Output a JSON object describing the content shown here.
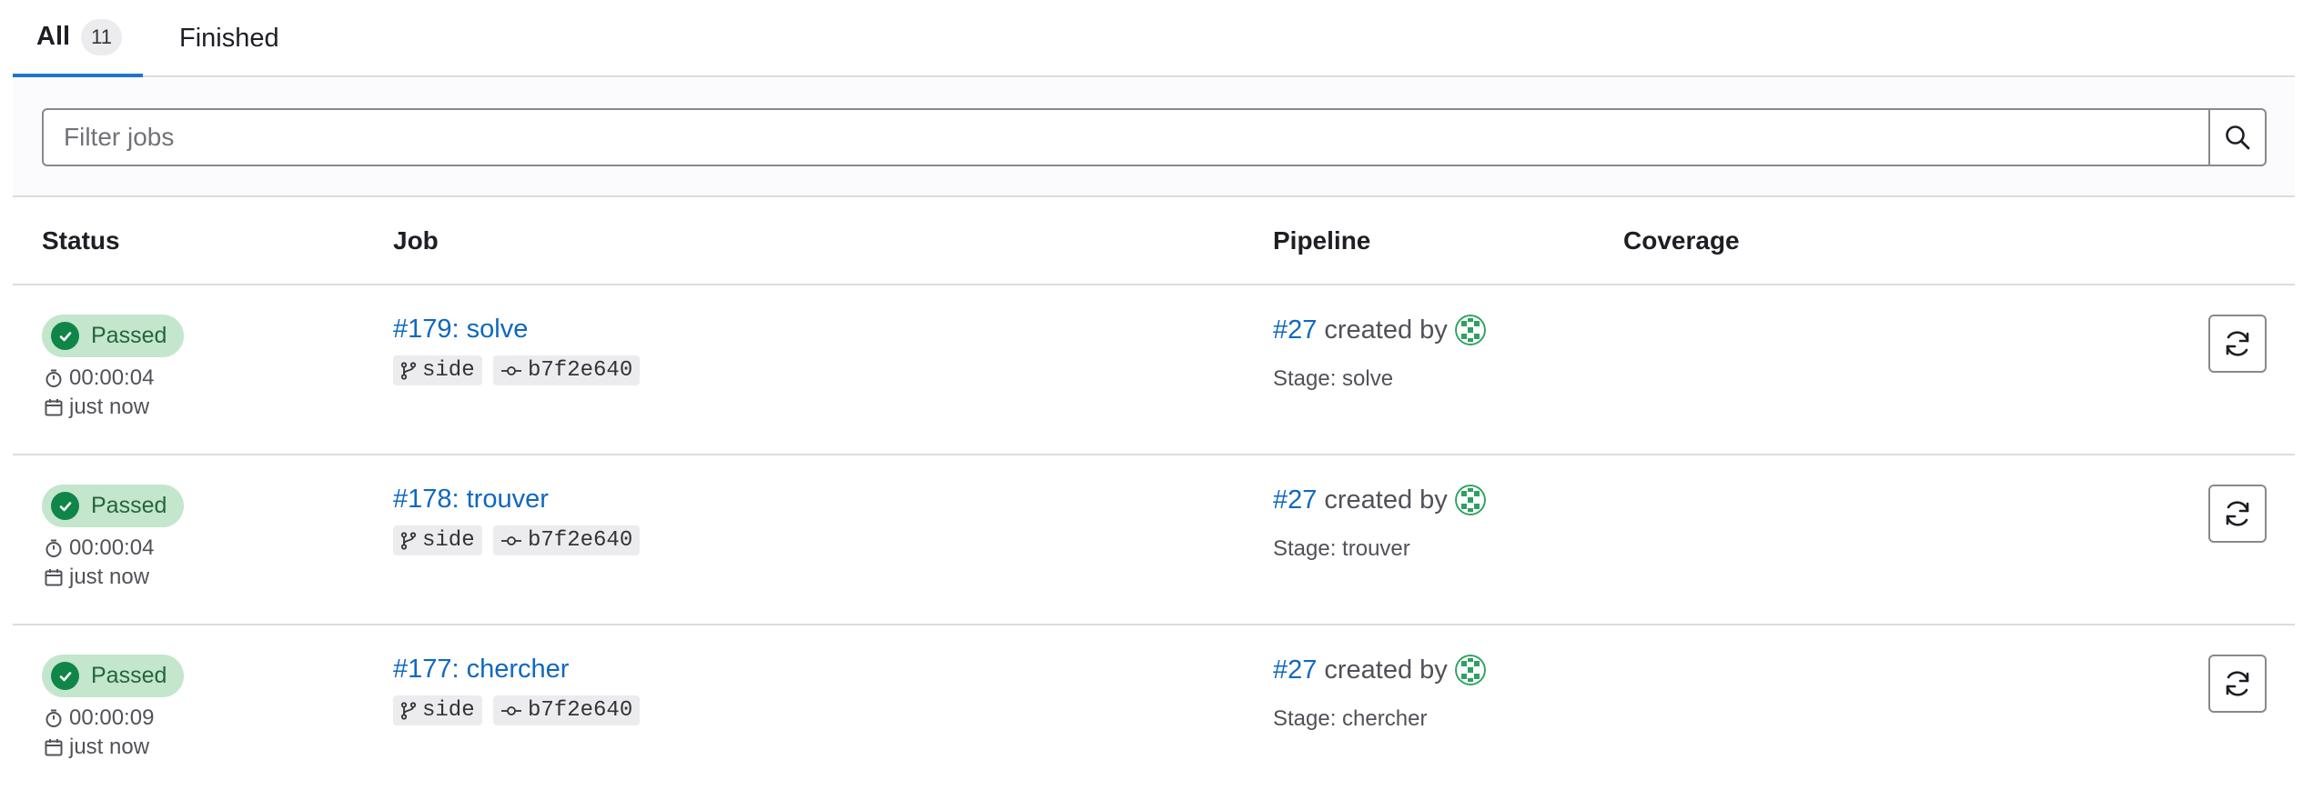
{
  "tabs": {
    "all_label": "All",
    "all_count": "11",
    "finished_label": "Finished"
  },
  "filter": {
    "placeholder": "Filter jobs"
  },
  "columns": {
    "status": "Status",
    "job": "Job",
    "pipeline": "Pipeline",
    "coverage": "Coverage"
  },
  "colors": {
    "link": "#1068bf",
    "success_bg": "#c3e6cd",
    "success_fg": "#108548",
    "active_tab": "#1f75cb"
  },
  "jobs": [
    {
      "status": "Passed",
      "duration": "00:00:04",
      "finished": "just now",
      "job": "#179: solve",
      "branch": "side",
      "commit": "b7f2e640",
      "pipeline": "#27",
      "created_by": "created by",
      "stage": "Stage: solve"
    },
    {
      "status": "Passed",
      "duration": "00:00:04",
      "finished": "just now",
      "job": "#178: trouver",
      "branch": "side",
      "commit": "b7f2e640",
      "pipeline": "#27",
      "created_by": "created by",
      "stage": "Stage: trouver"
    },
    {
      "status": "Passed",
      "duration": "00:00:09",
      "finished": "just now",
      "job": "#177: chercher",
      "branch": "side",
      "commit": "b7f2e640",
      "pipeline": "#27",
      "created_by": "created by",
      "stage": "Stage: chercher"
    }
  ]
}
